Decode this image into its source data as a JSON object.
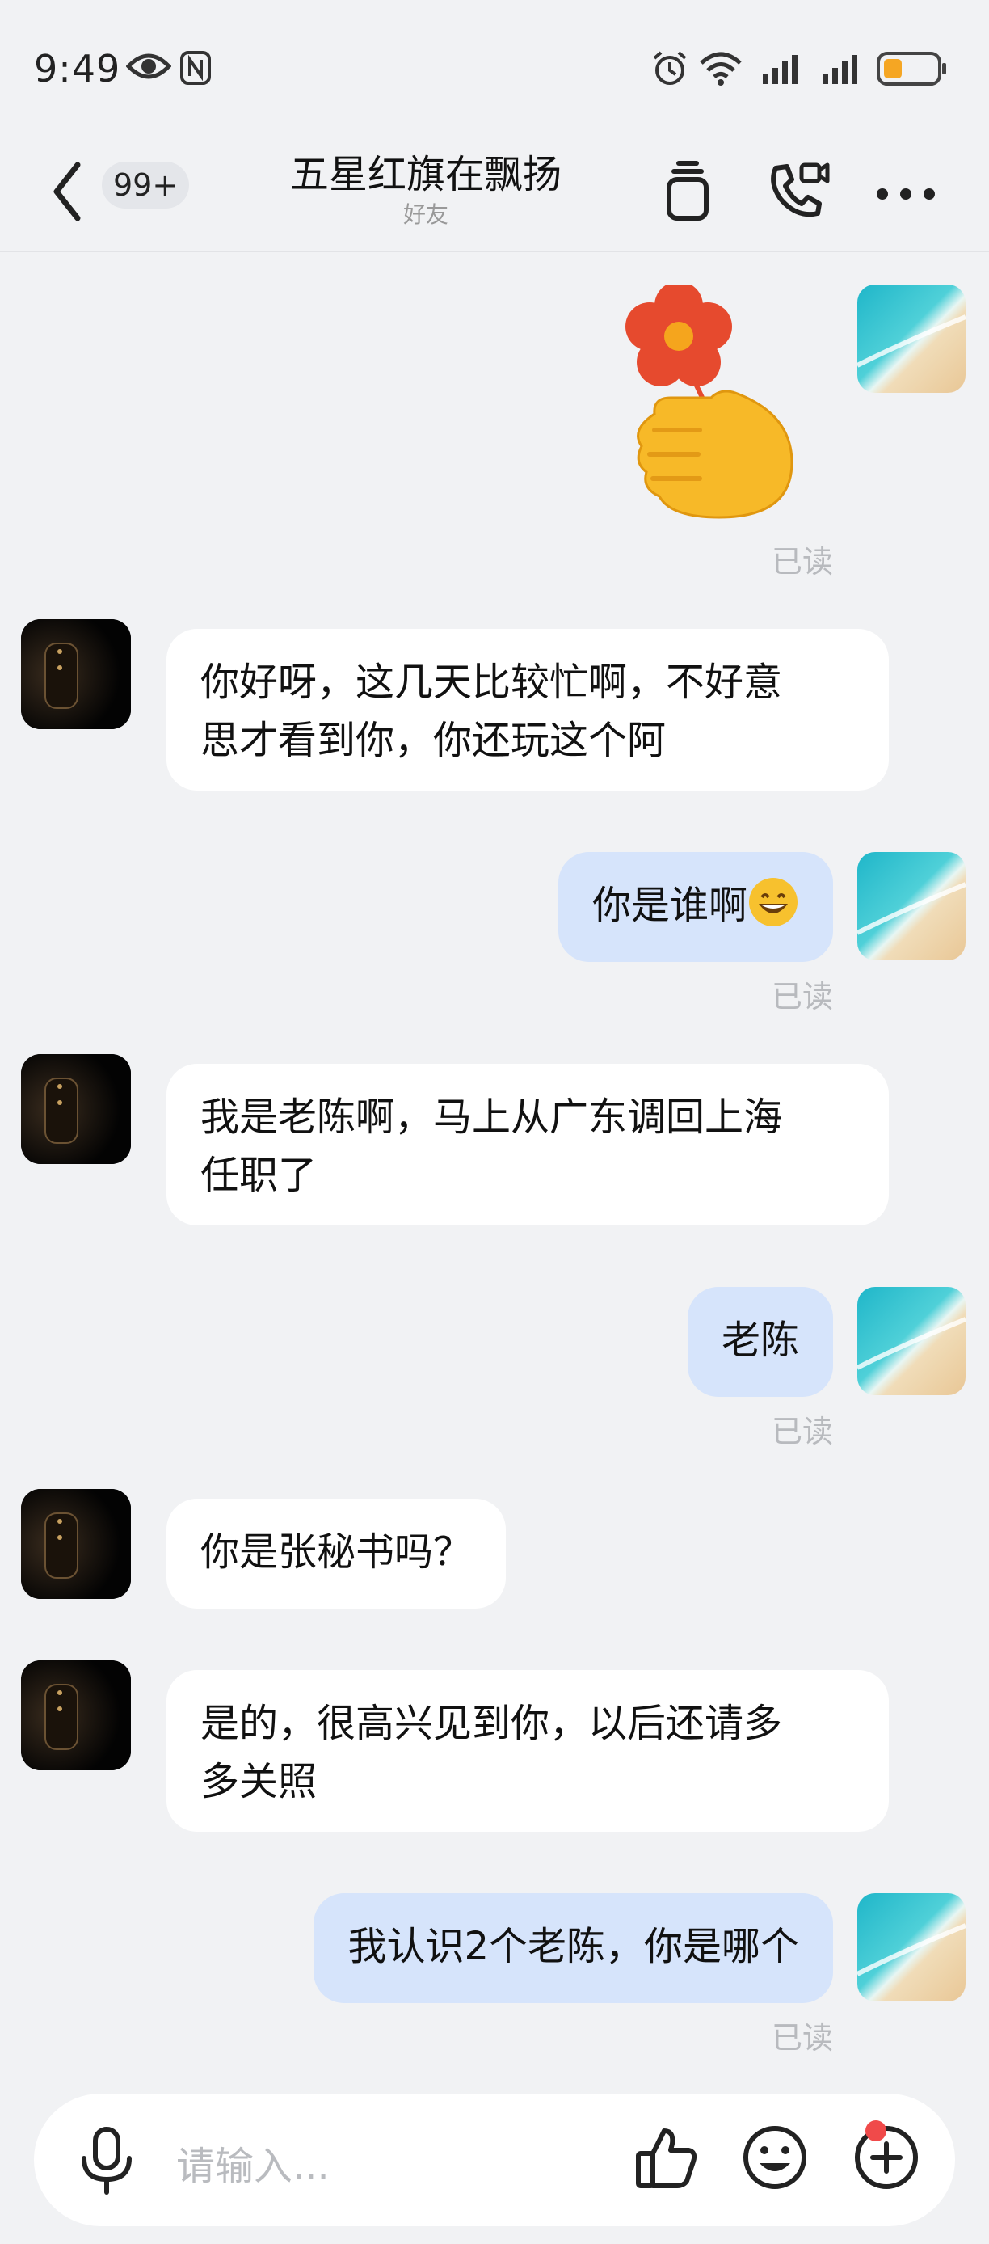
{
  "status": {
    "time": "9:49",
    "battery_color": "#f5a623"
  },
  "header": {
    "badge": "99+",
    "title": "五星红旗在飘扬",
    "subtitle": "好友"
  },
  "messages": [
    {
      "from": "me",
      "type": "sticker",
      "sticker": "flower-thumbs-up",
      "status": "已读"
    },
    {
      "from": "other",
      "text_lines": [
        "你好呀，这几天比较忙啊，不好意",
        "思才看到你，你还玩这个阿"
      ]
    },
    {
      "from": "me",
      "text": "你是谁啊",
      "emoji": "grinning-face",
      "status": "已读"
    },
    {
      "from": "other",
      "text_lines": [
        "我是老陈啊，马上从广东调回上海",
        "任职了"
      ]
    },
    {
      "from": "me",
      "text": "老陈",
      "status": "已读"
    },
    {
      "from": "other",
      "text": "你是张秘书吗？"
    },
    {
      "from": "other",
      "text_lines": [
        "是的，很高兴见到你，以后还请多",
        "多关照"
      ]
    },
    {
      "from": "me",
      "text": "我认识2个老陈，你是哪个",
      "status": "已读"
    }
  ],
  "input": {
    "placeholder": "请输入..."
  },
  "colors": {
    "my_bubble": "#d6e4fb",
    "their_bubble": "#ffffff",
    "background": "#f1f2f4",
    "notification_dot": "#f04a4a"
  }
}
